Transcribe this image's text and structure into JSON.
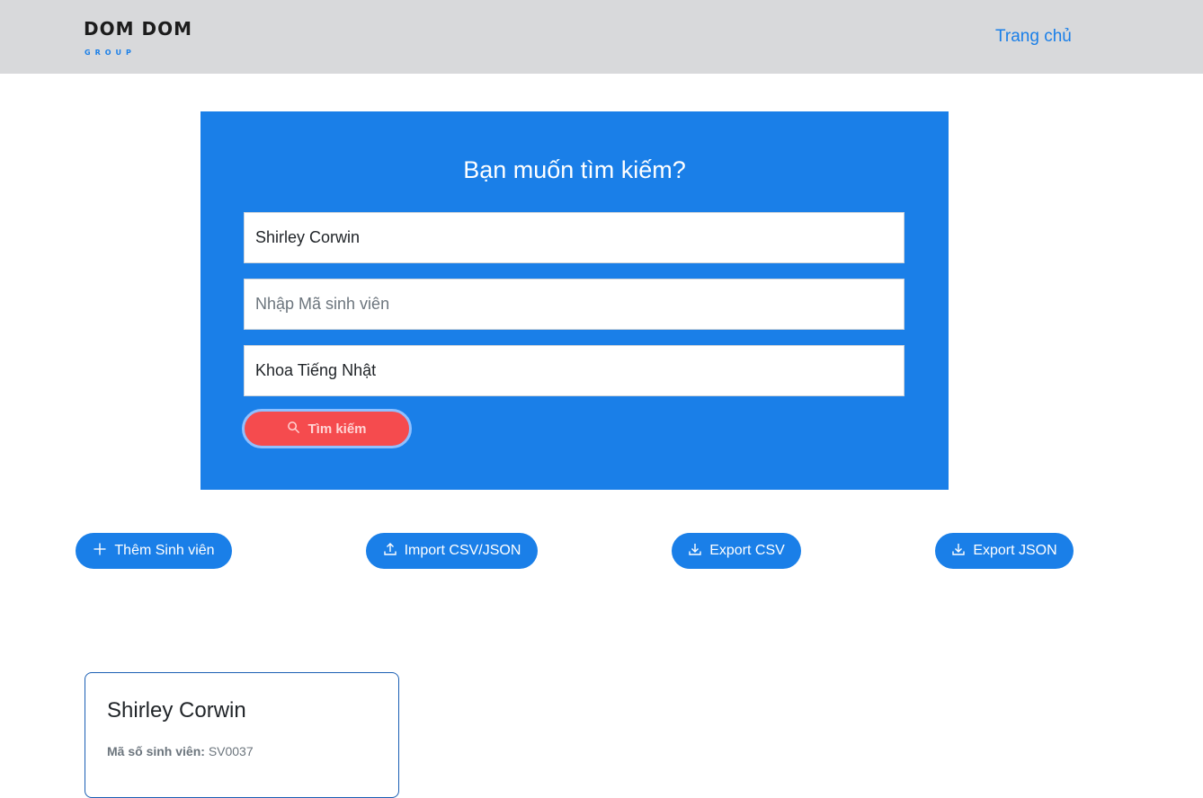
{
  "navbar": {
    "brand_name": "DOM DOM",
    "brand_sub": "GROUP",
    "home_link": "Trang chủ"
  },
  "search": {
    "title": "Bạn muốn tìm kiếm?",
    "name_value": "Shirley Corwin",
    "code_value": "",
    "code_placeholder": "Nhập Mã sinh viên",
    "dept_value": "Khoa Tiếng Nhật",
    "button_label": "Tìm kiếm"
  },
  "actions": {
    "add_label": "Thêm Sinh viên",
    "import_label": "Import CSV/JSON",
    "export_csv_label": "Export CSV",
    "export_json_label": "Export JSON"
  },
  "results": [
    {
      "name": "Shirley Corwin",
      "code_label": "Mã số sinh viên:",
      "code": "SV0037"
    }
  ],
  "colors": {
    "primary": "#1a7fe8",
    "danger": "#f54b4e",
    "navbar_bg": "#d8d9db"
  },
  "icons": {
    "search": "search-icon",
    "add": "plus-icon",
    "import": "upload-icon",
    "export": "download-icon"
  }
}
